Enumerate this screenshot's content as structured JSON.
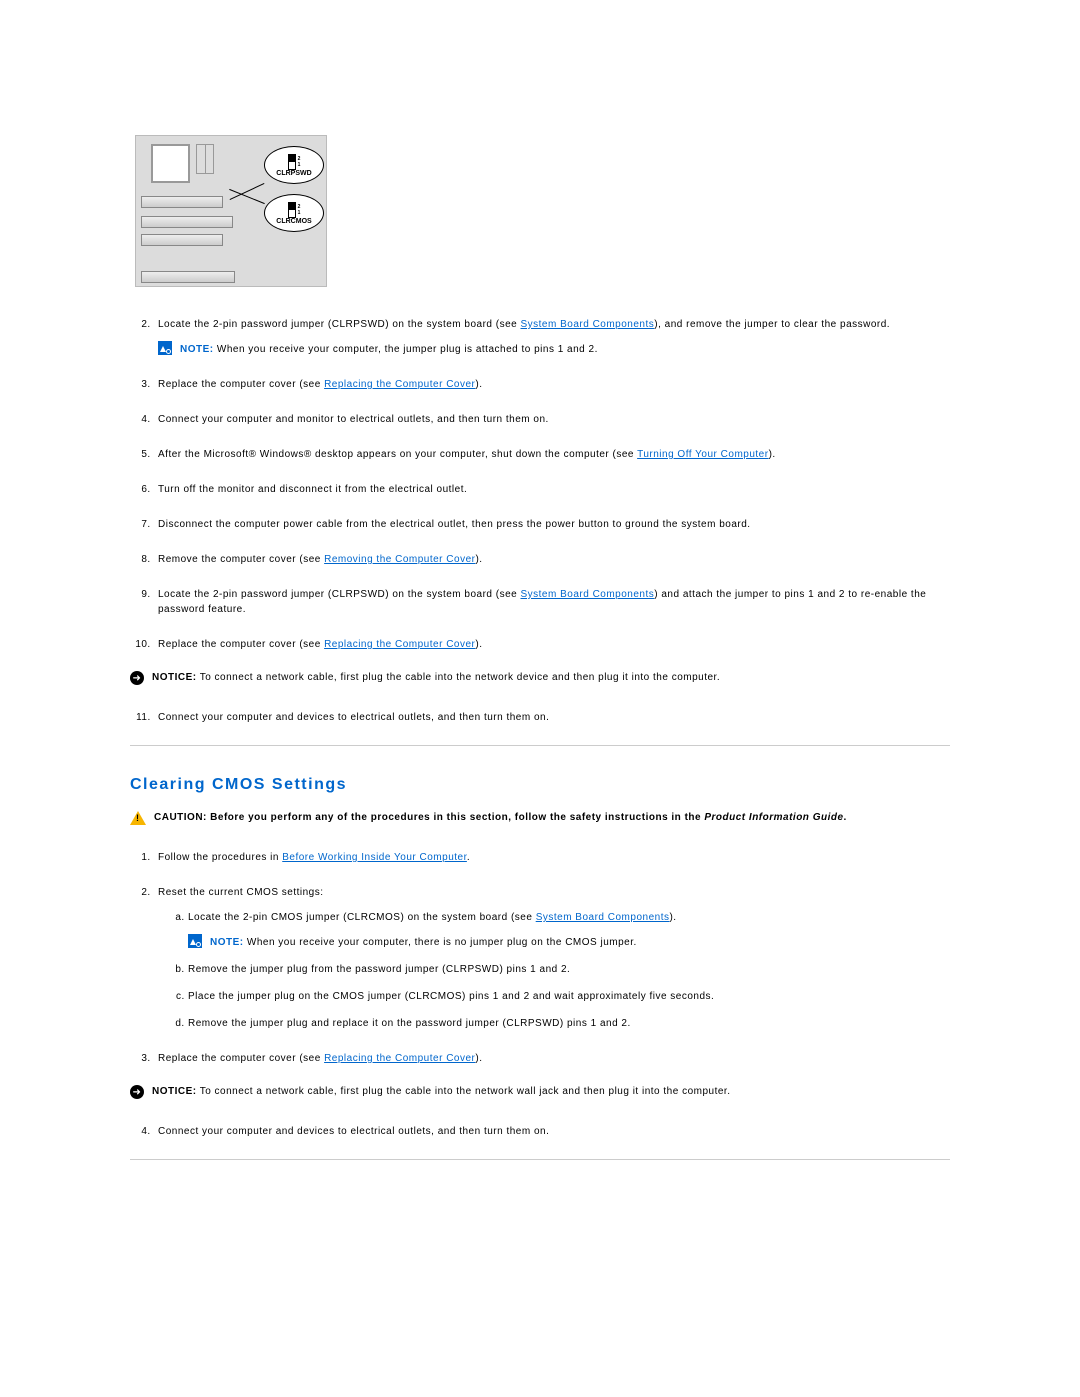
{
  "diagram": {
    "callout1_label": "CLRPSWD",
    "callout2_label": "CLRCMOS",
    "pin2": "2",
    "pin1": "1"
  },
  "section1": {
    "steps": {
      "s2_a": "Locate the 2-pin password jumper (CLRPSWD) on the system board (see ",
      "s2_link": "System Board Components",
      "s2_b": "), and remove the jumper to clear the password.",
      "s2_note_label": "NOTE:",
      "s2_note_text": " When you receive your computer, the jumper plug is attached to pins 1 and 2.",
      "s3_a": "Replace the computer cover (see ",
      "s3_link": "Replacing the Computer Cover",
      "s3_b": ").",
      "s4": "Connect your computer and monitor to electrical outlets, and then turn them on.",
      "s5_a": "After the Microsoft® Windows® desktop appears on your computer, shut down the computer (see ",
      "s5_link": "Turning Off Your Computer",
      "s5_b": ").",
      "s6": "Turn off the monitor and disconnect it from the electrical outlet.",
      "s7": "Disconnect the computer power cable from the electrical outlet, then press the power button to ground the system board.",
      "s8_a": "Remove the computer cover (see ",
      "s8_link": "Removing the Computer Cover",
      "s8_b": ").",
      "s9_a": "Locate the 2-pin password jumper (CLRPSWD) on the system board (see ",
      "s9_link": "System Board Components",
      "s9_b": ") and attach the jumper to pins 1 and 2 to re-enable the password feature.",
      "s10_a": "Replace the computer cover (see ",
      "s10_link": "Replacing the Computer Cover",
      "s10_b": ").",
      "notice_label": "NOTICE:",
      "notice_text": " To connect a network cable, first plug the cable into the network device and then plug it into the computer.",
      "s11": "Connect your computer and devices to electrical outlets, and then turn them on."
    }
  },
  "heading": "Clearing CMOS Settings",
  "section2": {
    "caution_label": "CAUTION: ",
    "caution_text_a": "Before you perform any of the procedures in this section, follow the safety instructions in the ",
    "caution_text_italic": "Product Information Guide",
    "caution_text_b": ".",
    "steps": {
      "s1_a": "Follow the procedures in ",
      "s1_link": "Before Working Inside Your Computer",
      "s1_b": ".",
      "s2": "Reset the current CMOS settings:",
      "s2a_a": "Locate the 2-pin CMOS jumper (CLRCMOS) on the system board (see ",
      "s2a_link": "System Board Components",
      "s2a_b": ").",
      "s2_note_label": "NOTE:",
      "s2_note_text": " When you receive your computer, there is no jumper plug on the CMOS jumper.",
      "s2b": "Remove the jumper plug from the password jumper (CLRPSWD) pins 1 and 2.",
      "s2c": "Place the jumper plug on the CMOS jumper (CLRCMOS) pins 1 and 2 and wait approximately five seconds.",
      "s2d": "Remove the jumper plug and replace it on the password jumper (CLRPSWD) pins 1 and 2.",
      "s3_a": "Replace the computer cover (see ",
      "s3_link": "Replacing the Computer Cover",
      "s3_b": ").",
      "notice_label": "NOTICE:",
      "notice_text": " To connect a network cable, first plug the cable into the network wall jack and then plug it into the computer.",
      "s4": "Connect your computer and devices to electrical outlets, and then turn them on."
    }
  }
}
